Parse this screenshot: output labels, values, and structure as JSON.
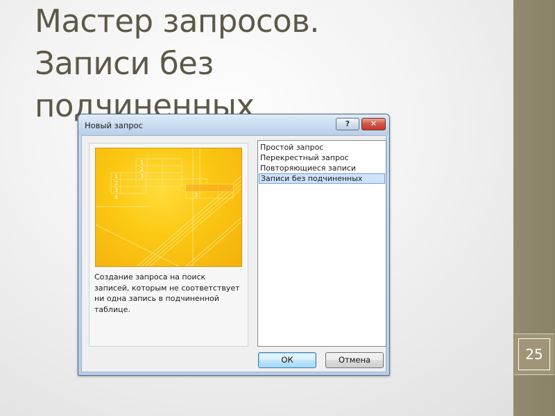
{
  "slide": {
    "title_lines": [
      "Мастер запросов.",
      "Записи без",
      "подчиненных"
    ],
    "page_number": "25"
  },
  "dialog": {
    "title": "Новый запрос",
    "help_button": "?",
    "close_button": "✕",
    "description": "Создание запроса на поиск записей, которым не соответствует ни одна запись в подчиненной таблице.",
    "preview_numbers": [
      "1",
      "2",
      "3",
      "1",
      "2",
      "3",
      "4",
      "3"
    ],
    "list_items": [
      {
        "label": "Простой запрос",
        "selected": false
      },
      {
        "label": "Перекрестный запрос",
        "selected": false
      },
      {
        "label": "Повторяющиеся записи",
        "selected": false
      },
      {
        "label": "Записи без подчиненных",
        "selected": true
      }
    ],
    "ok_button": "ОК",
    "cancel_button": "Отмена"
  }
}
